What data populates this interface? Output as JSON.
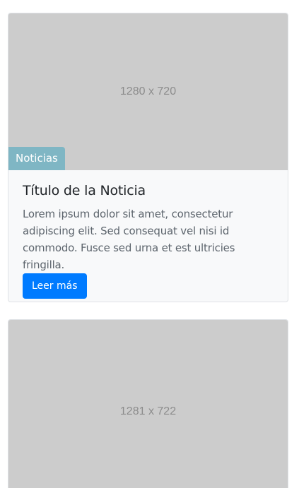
{
  "cards": [
    {
      "image_placeholder": "1280 x 720",
      "badge": "Noticias",
      "title": "Título de la Noticia",
      "text": "Lorem ipsum dolor sit amet, consectetur adipiscing elit. Sed consequat vel nisi id commodo. Fusce sed urna et est ultricies fringilla.",
      "button_label": "Leer más"
    },
    {
      "image_placeholder": "1281 x 722"
    }
  ],
  "colors": {
    "badge_bg": "#7fb6c4",
    "button_bg": "#007bff",
    "placeholder_bg": "#cccccc",
    "card_body_bg": "#f8f9fa"
  }
}
